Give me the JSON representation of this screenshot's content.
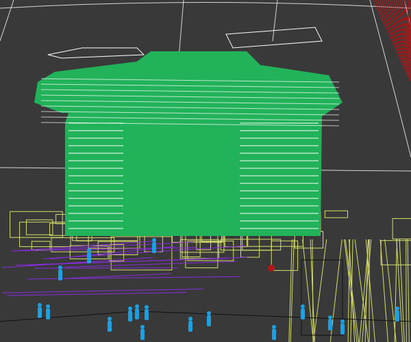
{
  "viewport": {
    "mode": "wireframe-3d-viewport",
    "colors": {
      "background": "#393939",
      "grid": "#d8d8d8",
      "building_fill": "#22b35a",
      "building_lines": "#ffffff",
      "podium_wire": "#d8e06a",
      "purple_wire": "#8a2be2",
      "people": "#1ea0e0",
      "red_wire": "#b01818",
      "dark_wire": "#111111"
    }
  }
}
